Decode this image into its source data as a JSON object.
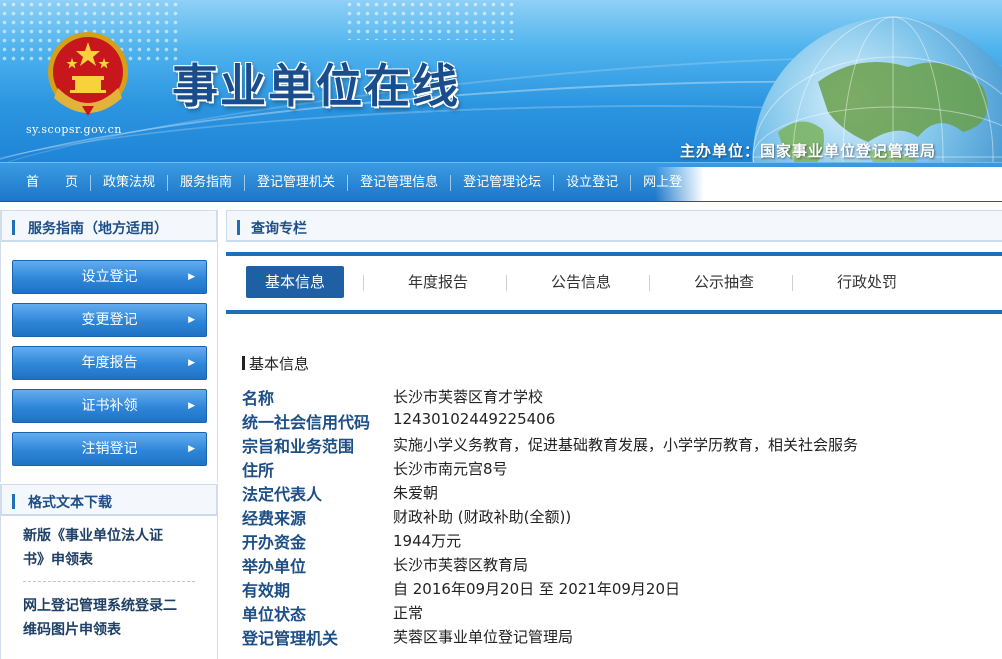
{
  "header": {
    "site_title": "事业单位在线",
    "site_url": "sy.scopsr.gov.cn",
    "host_label": "主办单位：国家事业单位登记管理局",
    "emblem_icon": "national-emblem-icon",
    "globe_icon": "globe-icon"
  },
  "nav": {
    "items": [
      "首　　页",
      "政策法规",
      "服务指南",
      "登记管理机关",
      "登记管理信息",
      "登记管理论坛",
      "设立登记",
      "网上登"
    ]
  },
  "sidebar": {
    "service_title": "服务指南（地方适用）",
    "service_buttons": [
      "设立登记",
      "变更登记",
      "年度报告",
      "证书补领",
      "注销登记"
    ],
    "download_title": "格式文本下载",
    "downloads": [
      {
        "line1": "新版《事业单位法人证",
        "line2": "书》申领表"
      },
      {
        "line1": "网上登记管理系统登录二",
        "line2": "维码图片申领表"
      }
    ]
  },
  "main": {
    "query_title": "查询专栏",
    "tabs": [
      "基本信息",
      "年度报告",
      "公告信息",
      "公示抽查",
      "行政处罚"
    ],
    "active_tab": "基本信息",
    "info_title": "基本信息",
    "fields": [
      {
        "label": "名称",
        "value": "长沙市芙蓉区育才学校"
      },
      {
        "label": "统一社会信用代码",
        "value": "12430102449225406"
      },
      {
        "label": "宗旨和业务范围",
        "value": "实施小学义务教育，促进基础教育发展，小学学历教育，相关社会服务"
      },
      {
        "label": "住所",
        "value": "长沙市南元宫8号"
      },
      {
        "label": "法定代表人",
        "value": "朱爱朝"
      },
      {
        "label": "经费来源",
        "value": "财政补助 (财政补助(全额))"
      },
      {
        "label": "开办资金",
        "value": "1944万元"
      },
      {
        "label": "举办单位",
        "value": "长沙市芙蓉区教育局"
      },
      {
        "label": "有效期",
        "value": "自 2016年09月20日 至 2021年09月20日"
      },
      {
        "label": "单位状态",
        "value": "正常"
      },
      {
        "label": "登记管理机关",
        "value": "芙蓉区事业单位登记管理局"
      }
    ]
  },
  "colors": {
    "banner_blue": "#2c95e0",
    "title_blue": "#1a4d8c",
    "button_blue": "#2e86d9",
    "active_tab": "#1f5fa3",
    "label_blue": "#1d4f86"
  }
}
